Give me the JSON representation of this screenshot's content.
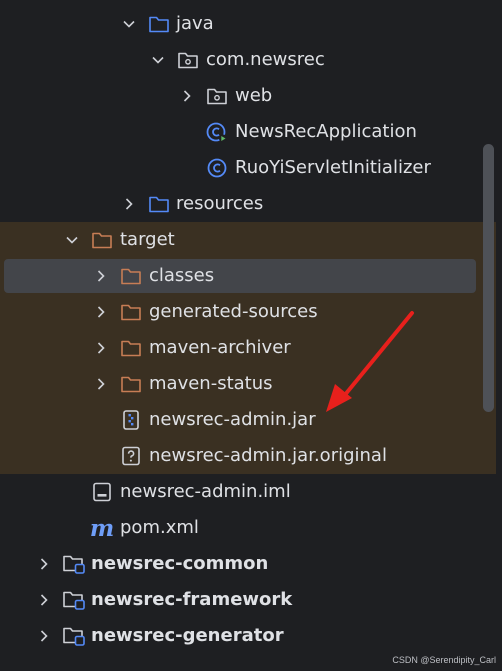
{
  "tree": {
    "rows": [
      {
        "label": "java",
        "icon": "folder-blue-icon"
      },
      {
        "label": "com.newsrec",
        "icon": "package-icon"
      },
      {
        "label": "web",
        "icon": "package-icon"
      },
      {
        "label": "NewsRecApplication",
        "icon": "spring-boot-class-icon"
      },
      {
        "label": "RuoYiServletInitializer",
        "icon": "class-icon"
      },
      {
        "label": "resources",
        "icon": "folder-blue-icon"
      },
      {
        "label": "target",
        "icon": "folder-orange-icon"
      },
      {
        "label": "classes",
        "icon": "folder-orange-icon"
      },
      {
        "label": "generated-sources",
        "icon": "folder-orange-icon"
      },
      {
        "label": "maven-archiver",
        "icon": "folder-orange-icon"
      },
      {
        "label": "maven-status",
        "icon": "folder-orange-icon"
      },
      {
        "label": "newsrec-admin.jar",
        "icon": "jar-icon"
      },
      {
        "label": "newsrec-admin.jar.original",
        "icon": "unknown-file-icon"
      },
      {
        "label": "newsrec-admin.iml",
        "icon": "iml-file-icon"
      },
      {
        "label": "pom.xml",
        "icon": "maven-icon"
      },
      {
        "label": "newsrec-common",
        "icon": "module-icon"
      },
      {
        "label": "newsrec-framework",
        "icon": "module-icon"
      },
      {
        "label": "newsrec-generator",
        "icon": "module-icon"
      }
    ]
  },
  "watermark": "CSDN @Serendipity_Carl",
  "colors": {
    "background": "#1e1f22",
    "excluded_highlight": "#3a3022",
    "selection": "#43454a",
    "text": "#dfe1e5",
    "folder_blue": "#548af7",
    "folder_orange": "#c77d55",
    "annotation_arrow": "#e8201c"
  }
}
